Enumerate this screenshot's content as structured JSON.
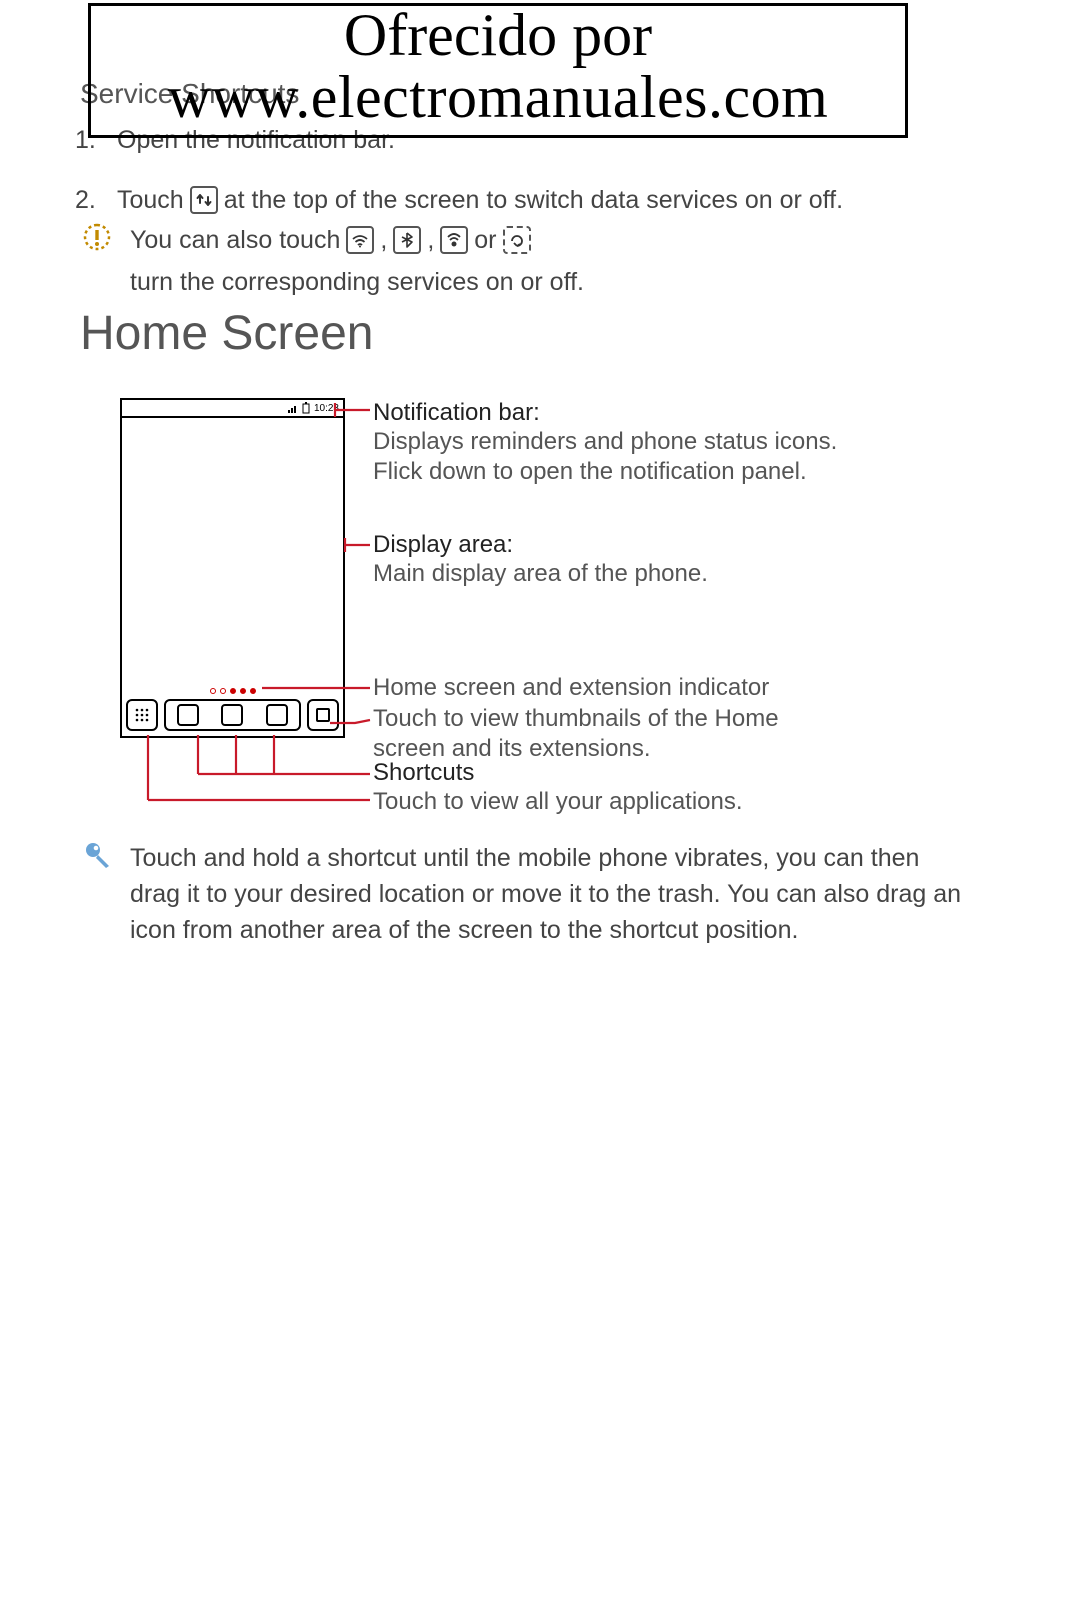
{
  "watermark": {
    "line1": "Ofrecido por",
    "line2": "www.electromanuales.com"
  },
  "subheading": "Service Shortcuts",
  "steps": {
    "n1": "1.",
    "t1": "Open the notification bar.",
    "n2": "2.",
    "t2a": "Touch",
    "t2b": "at the top of the screen to switch data services on or off."
  },
  "info_note": {
    "a": "You can also touch",
    "c1": ",",
    "c2": ",",
    "or": "or",
    "b": "turn the corresponding services on or off."
  },
  "section_heading": "Home Screen",
  "phone": {
    "time": "10:23"
  },
  "callouts": {
    "c1_title": "Notification bar:",
    "c1_body1": "Displays reminders and phone status icons.",
    "c1_body2": "Flick down to open the notification panel.",
    "c2_title": "Display area:",
    "c2_body": "Main display area of the phone.",
    "c3_body": "Home screen and extension indicator",
    "c4_body1": "Touch to view thumbnails of the Home",
    "c4_body2": "screen and its extensions.",
    "c5_title": "Shortcuts",
    "c6_body": "Touch to view all your applications."
  },
  "tip": {
    "text": "Touch and hold a shortcut until the mobile phone vibrates, you can then drag it to your desired location or move it to the trash. You can also drag an icon from another area of the screen to the shortcut position."
  }
}
